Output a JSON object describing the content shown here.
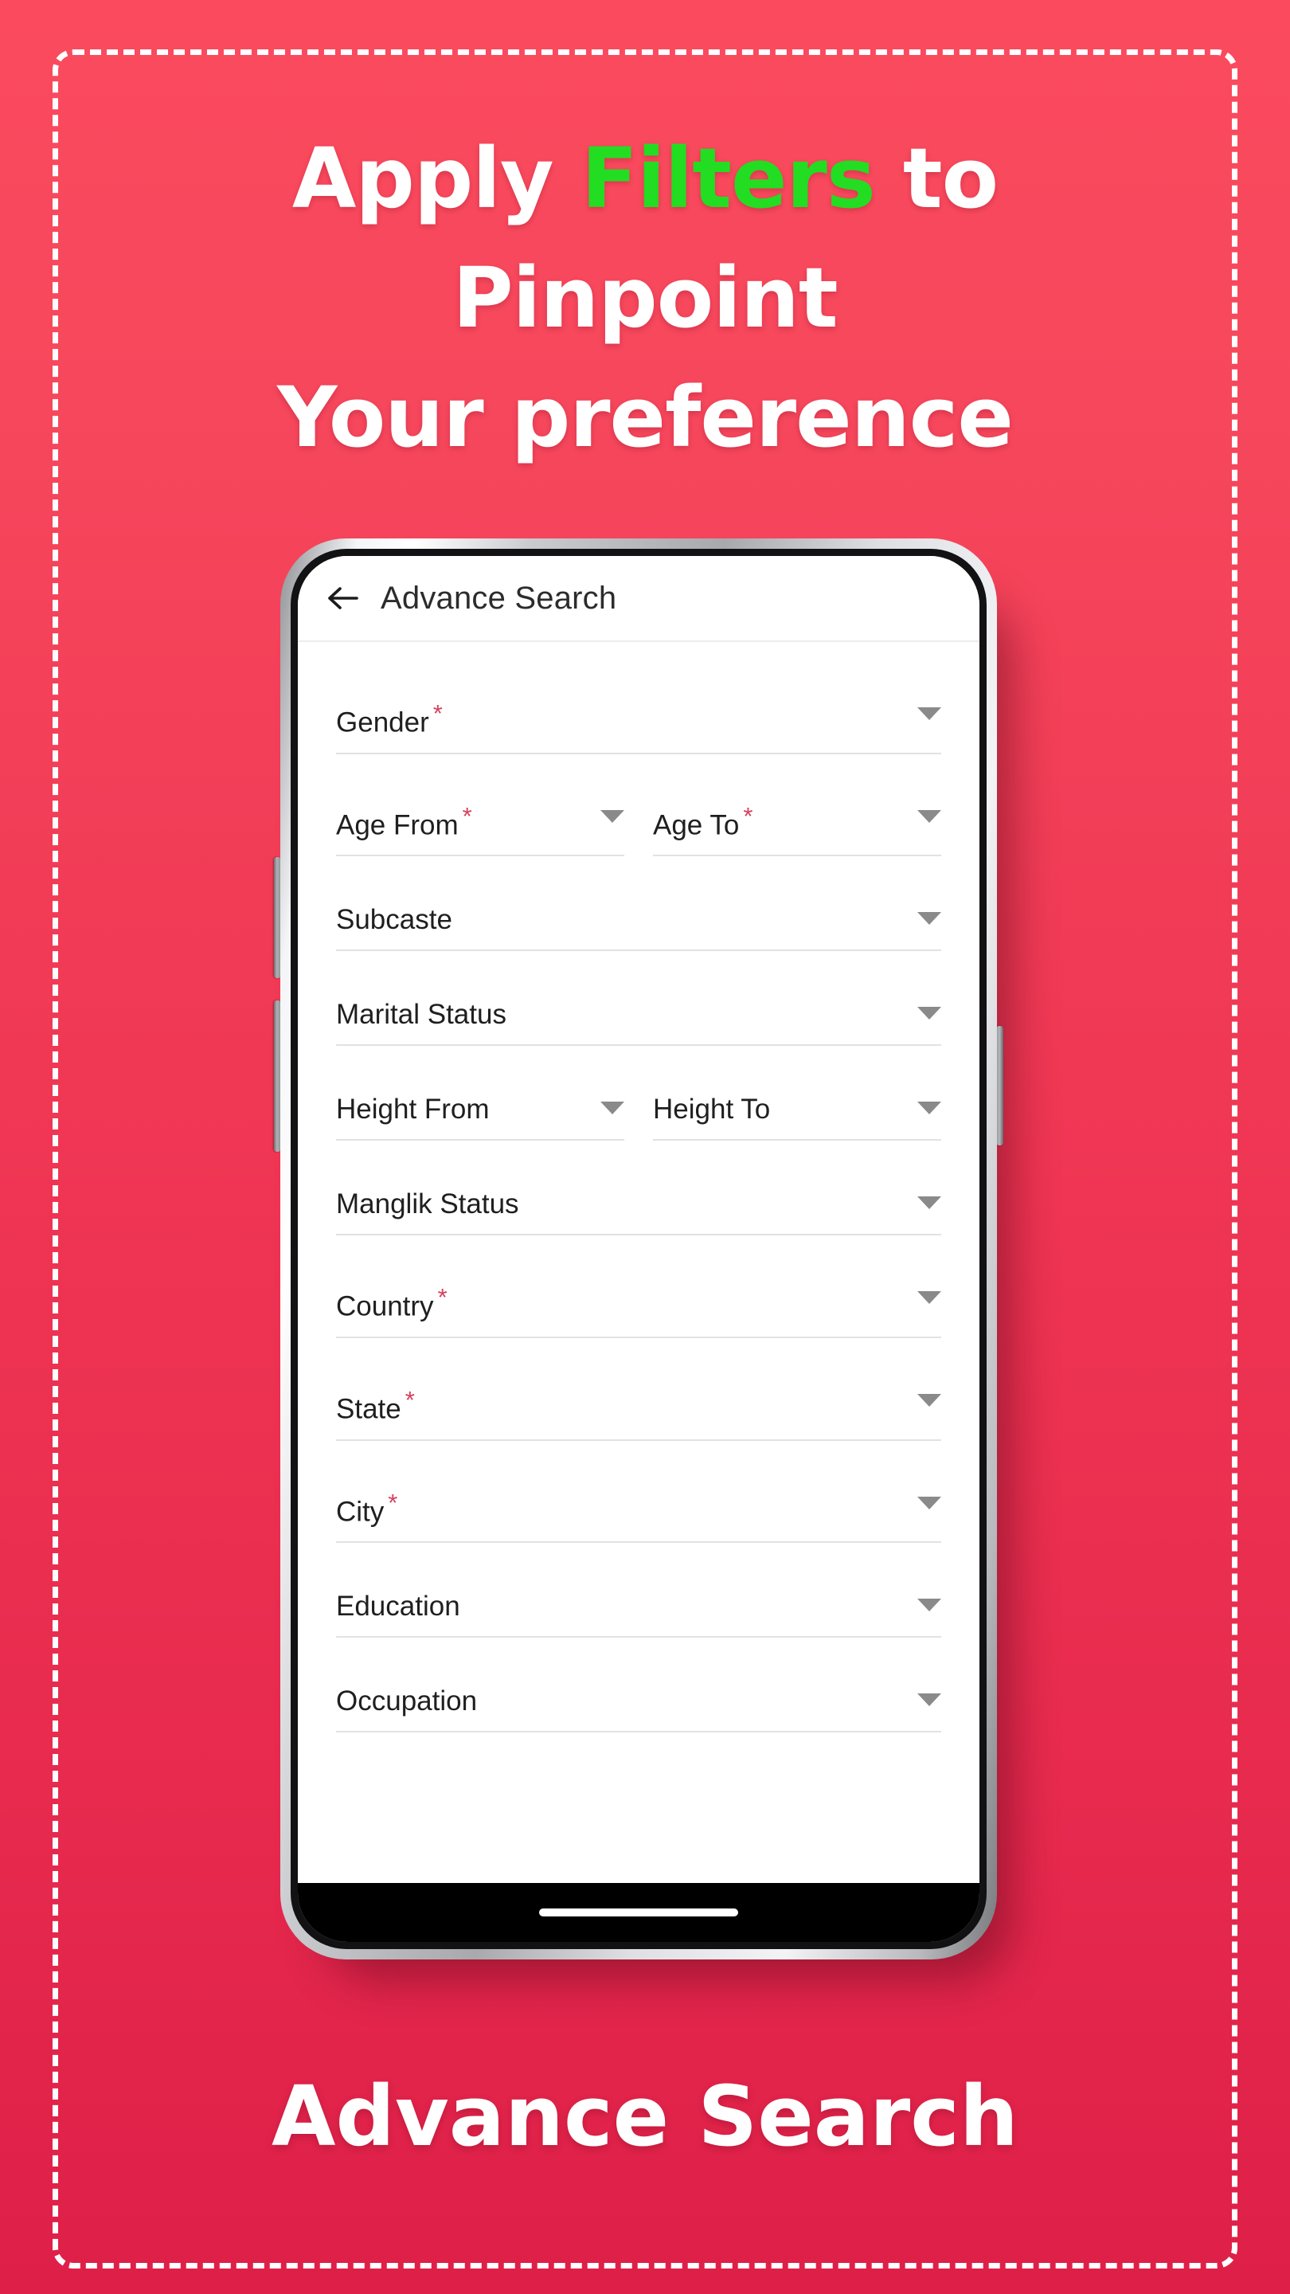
{
  "promo": {
    "headline": {
      "line1_pre": "Apply ",
      "line1_accent": "Filters",
      "line1_post": " to",
      "line2": "Pinpoint",
      "line3": "Your preference"
    },
    "caption": "Advance Search",
    "colors": {
      "background_top": "#FB4A5E",
      "background_bottom": "#DE1F48",
      "accent_green": "#22DD22",
      "dash_border": "#FFFFFF",
      "required_star": "#D5415E"
    }
  },
  "phone": {
    "app_bar": {
      "back_icon": "arrow-left-icon",
      "title": "Advance Search"
    },
    "form": {
      "rows": [
        {
          "layout": "full",
          "fields": [
            {
              "label": "Gender",
              "required": true,
              "value": "",
              "caret": "caret-down-icon"
            }
          ]
        },
        {
          "layout": "split",
          "fields": [
            {
              "label": "Age From",
              "required": true,
              "value": "",
              "caret": "caret-down-icon"
            },
            {
              "label": "Age To",
              "required": true,
              "value": "",
              "caret": "caret-down-icon"
            }
          ]
        },
        {
          "layout": "full",
          "fields": [
            {
              "label": "Subcaste",
              "required": false,
              "value": "",
              "caret": "caret-down-icon"
            }
          ]
        },
        {
          "layout": "full",
          "fields": [
            {
              "label": "Marital Status",
              "required": false,
              "value": "",
              "caret": "caret-down-icon"
            }
          ]
        },
        {
          "layout": "split",
          "fields": [
            {
              "label": "Height From",
              "required": false,
              "value": "",
              "caret": "caret-down-icon"
            },
            {
              "label": "Height To",
              "required": false,
              "value": "",
              "caret": "caret-down-icon"
            }
          ]
        },
        {
          "layout": "full",
          "fields": [
            {
              "label": "Manglik Status",
              "required": false,
              "value": "",
              "caret": "caret-down-icon"
            }
          ]
        },
        {
          "layout": "full",
          "fields": [
            {
              "label": "Country",
              "required": true,
              "value": "",
              "caret": "caret-down-icon"
            }
          ]
        },
        {
          "layout": "full",
          "fields": [
            {
              "label": "State",
              "required": true,
              "value": "",
              "caret": "caret-down-icon"
            }
          ]
        },
        {
          "layout": "full",
          "fields": [
            {
              "label": "City",
              "required": true,
              "value": "",
              "caret": "caret-down-icon"
            }
          ]
        },
        {
          "layout": "full",
          "fields": [
            {
              "label": "Education",
              "required": false,
              "value": "",
              "caret": "caret-down-icon"
            }
          ]
        },
        {
          "layout": "full",
          "fields": [
            {
              "label": "Occupation",
              "required": false,
              "value": "",
              "caret": "caret-down-icon"
            }
          ]
        }
      ]
    },
    "hardware": {
      "buttons": [
        "volume-up-button",
        "volume-down-button",
        "power-button"
      ],
      "nav_gesture_pill": "home-gesture-pill"
    }
  }
}
